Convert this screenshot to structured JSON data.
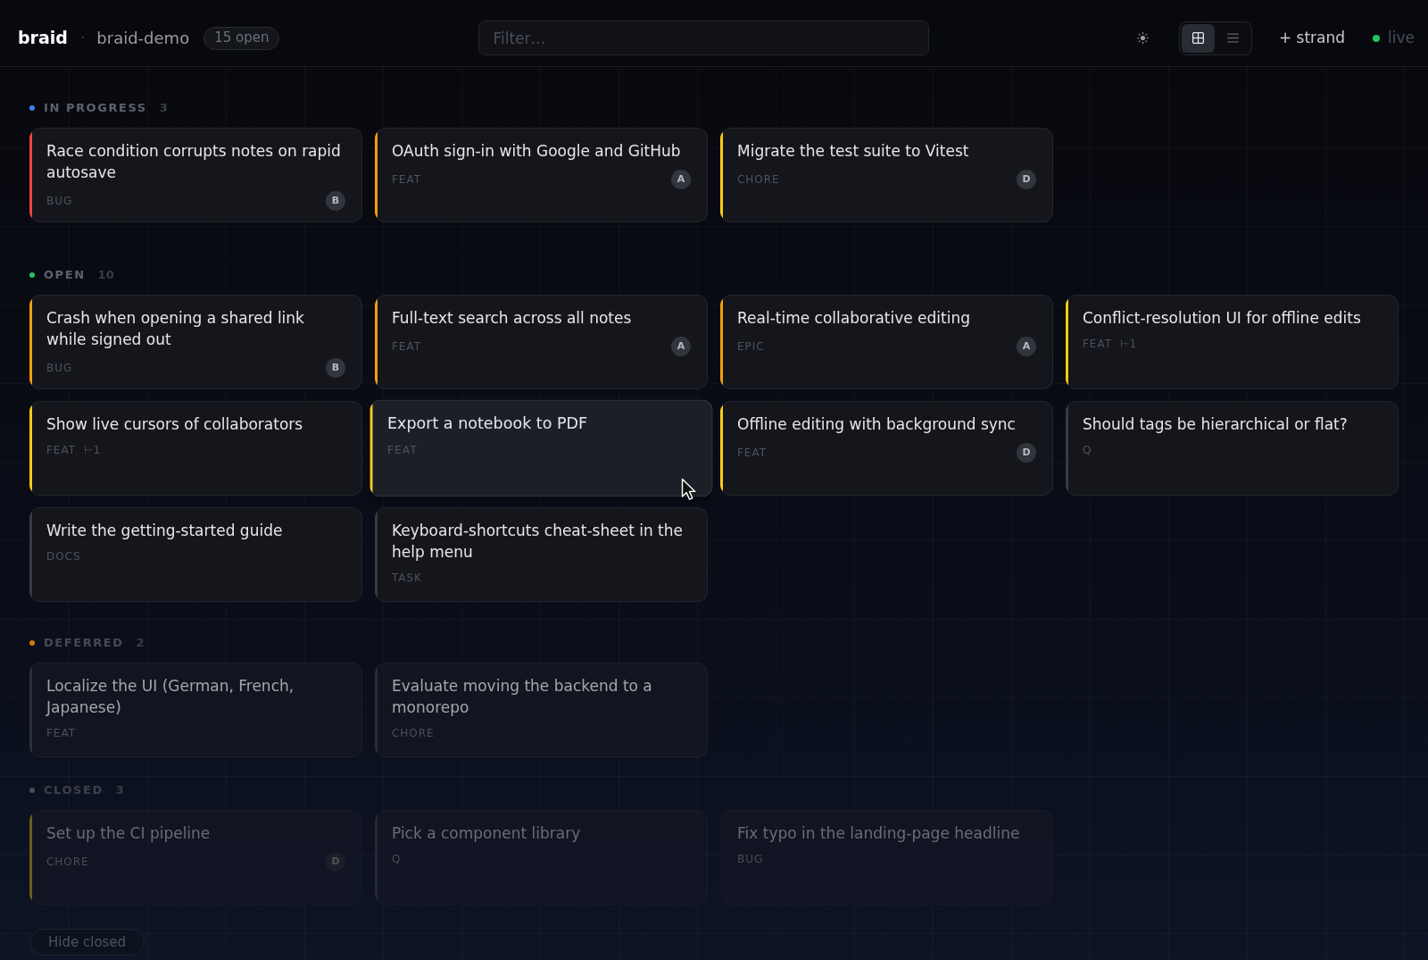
{
  "header": {
    "logo": "braid",
    "separator": "·",
    "project": "braid-demo",
    "badge": "15 open",
    "filter": {
      "placeholder": "Filter…"
    },
    "view_toggle": [
      {
        "kind": "grid",
        "selected": true
      },
      {
        "kind": "list",
        "selected": false
      }
    ],
    "new_button": "+ strand",
    "status": "live"
  },
  "sections": [
    {
      "title": "IN PROGRESS",
      "count": "3",
      "color": "#3b82f6",
      "kind": "active",
      "cards": [
        {
          "title": "Race condition corrupts notes on rapid autosave",
          "tag": "BUG",
          "assignee": "B",
          "color": "#ef4444",
          "hovered": false
        },
        {
          "title": "OAuth sign-in with Google and GitHub",
          "tag": "FEAT",
          "assignee": "A",
          "color": "#f59e0b",
          "hovered": false
        },
        {
          "title": "Migrate the test suite to Vitest",
          "tag": "CHORE",
          "assignee": "D",
          "color": "#facc15",
          "hovered": false
        }
      ]
    },
    {
      "title": "OPEN",
      "count": "10",
      "color": "#22c55e",
      "kind": "active",
      "cards": [
        {
          "title": "Crash when opening a shared link while signed out",
          "tag": "BUG",
          "assignee": "B",
          "color": "#f59e0b",
          "hovered": false
        },
        {
          "title": "Full-text search across all notes",
          "tag": "FEAT",
          "assignee": "A",
          "color": "#f59e0b",
          "hovered": false
        },
        {
          "title": "Real-time collaborative editing",
          "tag": "EPIC",
          "assignee": "A",
          "color": "#f59e0b",
          "hovered": false
        },
        {
          "title": "Conflict-resolution UI for offline edits",
          "tag": "FEAT",
          "subtasks": "⊢1",
          "color": "#facc15",
          "hovered": false
        },
        {
          "title": "Show live cursors of collaborators",
          "tag": "FEAT",
          "subtasks": "⊢1",
          "color": "#facc15",
          "hovered": false
        },
        {
          "title": "Export a notebook to PDF",
          "tag": "FEAT",
          "color": "#facc15",
          "hovered": true
        },
        {
          "title": "Offline editing with background sync",
          "tag": "FEAT",
          "assignee": "D",
          "color": "#facc15",
          "hovered": false
        },
        {
          "title": "Should tags be hierarchical or flat?",
          "tag": "Q",
          "color": "#3a3b42",
          "hovered": false
        },
        {
          "title": "Write the getting-started guide",
          "tag": "DOCS",
          "color": "#3a3b42",
          "hovered": false
        },
        {
          "title": "Keyboard-shortcuts cheat-sheet in the help menu",
          "tag": "TASK",
          "color": "#3a3b42",
          "hovered": false
        }
      ]
    },
    {
      "title": "DEFERRED",
      "count": "2",
      "color": "#d97706",
      "kind": "deferred",
      "cards": [
        {
          "title": "Localize the UI (German, French, Japanese)",
          "tag": "FEAT",
          "color": "#2e3037",
          "hovered": false
        },
        {
          "title": "Evaluate moving the backend to a monorepo",
          "tag": "CHORE",
          "color": "#2a2c33",
          "hovered": false
        }
      ]
    },
    {
      "title": "CLOSED",
      "count": "3",
      "color": "#4b4e57",
      "kind": "closed",
      "cards": [
        {
          "title": "Set up the CI pipeline",
          "tag": "CHORE",
          "assignee": "D",
          "color": "#6e5d1c",
          "hovered": false
        },
        {
          "title": "Pick a component library",
          "tag": "Q",
          "color": "#262830",
          "hovered": false
        },
        {
          "title": "Fix typo in the landing-page headline",
          "tag": "BUG",
          "hovered": false
        }
      ]
    }
  ],
  "footer": {
    "toggle_closed": "Hide closed"
  }
}
